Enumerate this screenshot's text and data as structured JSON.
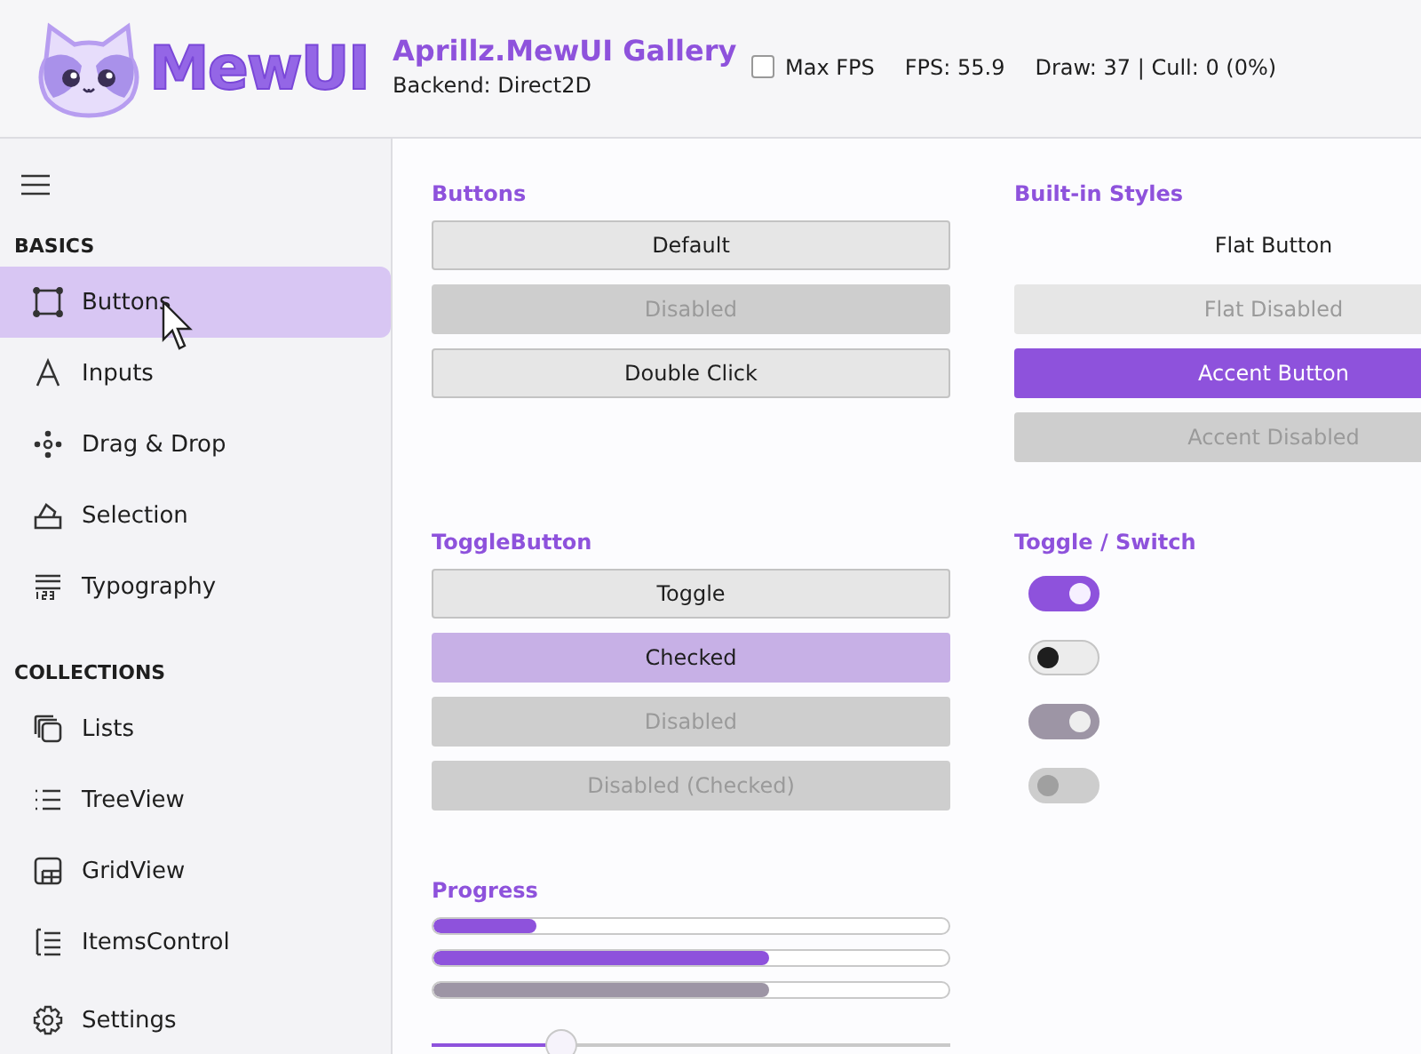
{
  "header": {
    "logo_text": "MewUI",
    "title": "Aprillz.MewUI Gallery",
    "backend": "Backend: Direct2D",
    "max_fps": {
      "label": "Max FPS",
      "checked": false
    },
    "fps": "FPS: 55.9",
    "stats": "Draw: 37 | Cull: 0 (0%)"
  },
  "sidebar": {
    "groups": [
      {
        "title": "BASICS",
        "items": [
          {
            "label": "Buttons",
            "selected": true
          },
          {
            "label": "Inputs",
            "selected": false
          },
          {
            "label": "Drag & Drop",
            "selected": false
          },
          {
            "label": "Selection",
            "selected": false
          },
          {
            "label": "Typography",
            "selected": false
          }
        ]
      },
      {
        "title": "COLLECTIONS",
        "items": [
          {
            "label": "Lists",
            "selected": false
          },
          {
            "label": "TreeView",
            "selected": false
          },
          {
            "label": "GridView",
            "selected": false
          },
          {
            "label": "ItemsControl",
            "selected": false
          }
        ]
      }
    ],
    "footer": {
      "label": "Settings",
      "selected": false
    }
  },
  "sections": [
    {
      "title": "Buttons",
      "kind": "buttons",
      "items": [
        {
          "label": "Default",
          "kind": "default",
          "disabled": false
        },
        {
          "label": "Disabled",
          "kind": "default",
          "disabled": true
        },
        {
          "label": "Double Click",
          "kind": "default",
          "disabled": false
        }
      ]
    },
    {
      "title": "Built-in Styles",
      "kind": "buttons",
      "items": [
        {
          "label": "Flat Button",
          "kind": "flat",
          "disabled": false
        },
        {
          "label": "Flat Disabled",
          "kind": "flat",
          "disabled": true
        },
        {
          "label": "Accent Button",
          "kind": "accent",
          "disabled": false
        },
        {
          "label": "Accent Disabled",
          "kind": "accent",
          "disabled": true
        }
      ]
    },
    {
      "title": "ToggleButton",
      "kind": "toggles",
      "items": [
        {
          "label": "Toggle",
          "checked": false,
          "disabled": false
        },
        {
          "label": "Checked",
          "checked": true,
          "disabled": false
        },
        {
          "label": "Disabled",
          "disabled": true
        },
        {
          "label": "Disabled (Checked)",
          "disabled": true
        }
      ]
    },
    {
      "title": "Toggle / Switch",
      "kind": "switches",
      "items": [
        {
          "on": true,
          "disabled": false
        },
        {
          "on": false,
          "disabled": false
        },
        {
          "on": true,
          "disabled": true
        },
        {
          "on": false,
          "disabled": true
        }
      ]
    },
    {
      "title": "Progress",
      "kind": "progress",
      "items": [
        {
          "level": 0.2,
          "disabled": false
        },
        {
          "level": 0.65,
          "disabled": false
        },
        {
          "level": 0.65,
          "disabled": true
        }
      ],
      "slider": {
        "level": 0.25
      }
    }
  ]
}
